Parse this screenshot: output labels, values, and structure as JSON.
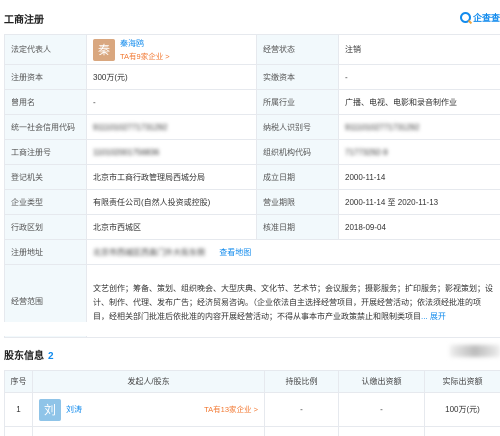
{
  "section": {
    "title": "工商注册",
    "logo_text": "企查查"
  },
  "reg": {
    "legal_rep_label": "法定代表人",
    "legal_rep_avatar": "秦",
    "legal_rep_name": "秦海鸥",
    "legal_rep_tag": "TA有9家企业 >",
    "status_label": "经营状态",
    "status_value": "注销",
    "capital_label": "注册资本",
    "capital_value": "300万(元)",
    "paid_label": "实缴资本",
    "paid_value": "-",
    "former_label": "曾用名",
    "former_value": "-",
    "industry_label": "所属行业",
    "industry_value": "广播、电视、电影和录音制作业",
    "uscc_label": "统一社会信用代码",
    "uscc_value": "91110102771731292",
    "taxid_label": "纳税人识别号",
    "taxid_value": "91110102771731292",
    "regno_label": "工商注册号",
    "regno_value": "110102001756836",
    "orgcode_label": "组织机构代码",
    "orgcode_value": "71773292-9",
    "authority_label": "登记机关",
    "authority_value": "北京市工商行政管理局西城分局",
    "established_label": "成立日期",
    "established_value": "2000-11-14",
    "type_label": "企业类型",
    "type_value": "有限责任公司(自然人投资或控股)",
    "term_label": "营业期限",
    "term_value": "2000-11-14 至 2020-11-13",
    "district_label": "行政区划",
    "district_value": "北京市西城区",
    "approved_label": "核准日期",
    "approved_value": "2018-09-04",
    "address_label": "注册地址",
    "address_value": "北京市西城区西直门外大街东侧",
    "map_link": "查看地图",
    "scope_label": "经营范围",
    "scope_value": "文艺创作；筹备、策划、组织晚会、大型庆典、文化节、艺术节；会议服务；摄影服务；扩印服务；影视策划；设计、制作、代理、发布广告；经济贸易咨询。（企业依法自主选择经营项目，开展经营活动；依法须经批准的项目，经相关部门批准后依批准的内容开展经营活动；不得从事本市产业政策禁止和限制类项目",
    "scope_more": "... 展开"
  },
  "shareholders": {
    "title": "股东信息",
    "count": "2",
    "columns": [
      "序号",
      "发起人/股东",
      "持股比例",
      "认缴出资额",
      "实际出资额"
    ],
    "rows": [
      {
        "index": "1",
        "avatar": "刘",
        "name": "刘涛",
        "tag": "TA有13家企业 >",
        "ratio": "-",
        "subscribed": "-",
        "actual": "100万(元)"
      }
    ]
  }
}
